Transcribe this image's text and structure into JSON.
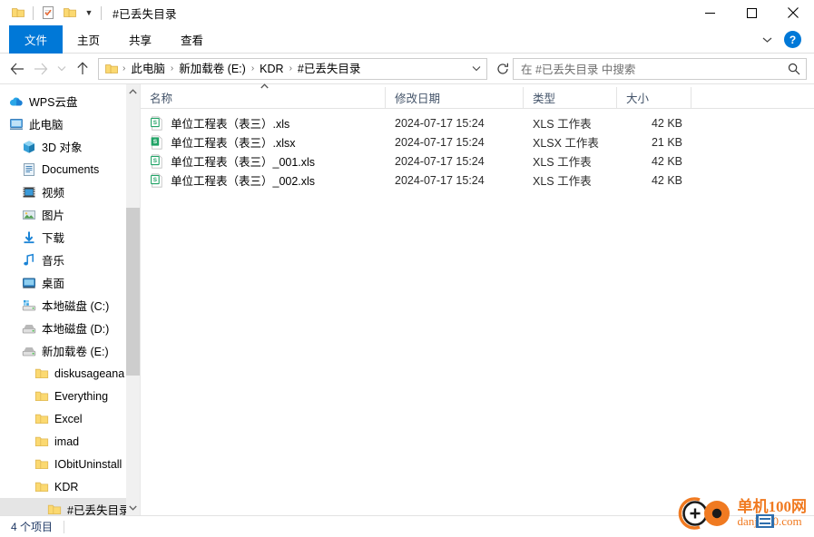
{
  "window": {
    "title": "#已丢失目录",
    "quick_access": [
      {
        "name": "folder-icon",
        "label": "文件夹"
      },
      {
        "name": "properties-icon",
        "label": "属性"
      },
      {
        "name": "new-folder-icon",
        "label": "新建文件夹"
      }
    ],
    "controls": {
      "minimize": "—",
      "maximize": "□",
      "close": "✕",
      "ribbon_chevron": "⌄",
      "help": "?"
    }
  },
  "ribbon": {
    "tabs": [
      {
        "label": "文件",
        "active": true
      },
      {
        "label": "主页",
        "active": false
      },
      {
        "label": "共享",
        "active": false
      },
      {
        "label": "查看",
        "active": false
      }
    ]
  },
  "address_bar": {
    "back": "←",
    "forward": "→",
    "recent": "⌄",
    "up": "↑",
    "breadcrumbs": [
      "此电脑",
      "新加载卷 (E:)",
      "KDR",
      "#已丢失目录"
    ],
    "separator": "›",
    "dropdown": "⌄",
    "refresh": "↺"
  },
  "search": {
    "placeholder": "在 #已丢失目录 中搜索",
    "icon": "search-icon"
  },
  "sidebar": {
    "items": [
      {
        "label": "WPS云盘",
        "icon": "cloud-icon",
        "indent": 0,
        "selected": false
      },
      {
        "label": "此电脑",
        "icon": "computer-icon",
        "indent": 0,
        "selected": false
      },
      {
        "label": "3D 对象",
        "icon": "3d-object-icon",
        "indent": 1,
        "selected": false
      },
      {
        "label": "Documents",
        "icon": "documents-icon",
        "indent": 1,
        "selected": false
      },
      {
        "label": "视频",
        "icon": "videos-icon",
        "indent": 1,
        "selected": false
      },
      {
        "label": "图片",
        "icon": "pictures-icon",
        "indent": 1,
        "selected": false
      },
      {
        "label": "下载",
        "icon": "downloads-icon",
        "indent": 1,
        "selected": false
      },
      {
        "label": "音乐",
        "icon": "music-icon",
        "indent": 1,
        "selected": false
      },
      {
        "label": "桌面",
        "icon": "desktop-icon",
        "indent": 1,
        "selected": false
      },
      {
        "label": "本地磁盘 (C:)",
        "icon": "drive-system-icon",
        "indent": 1,
        "selected": false
      },
      {
        "label": "本地磁盘 (D:)",
        "icon": "drive-icon",
        "indent": 1,
        "selected": false
      },
      {
        "label": "新加载卷 (E:)",
        "icon": "drive-icon",
        "indent": 1,
        "selected": false
      },
      {
        "label": "diskusageana",
        "icon": "folder-icon",
        "indent": 2,
        "selected": false
      },
      {
        "label": "Everything",
        "icon": "folder-icon",
        "indent": 2,
        "selected": false
      },
      {
        "label": "Excel",
        "icon": "folder-icon",
        "indent": 2,
        "selected": false
      },
      {
        "label": "imad",
        "icon": "folder-icon",
        "indent": 2,
        "selected": false
      },
      {
        "label": "IObitUninstall",
        "icon": "folder-icon",
        "indent": 2,
        "selected": false
      },
      {
        "label": "KDR",
        "icon": "folder-icon",
        "indent": 2,
        "selected": false
      },
      {
        "label": "#已丢失目录",
        "icon": "folder-icon",
        "indent": 3,
        "selected": true
      }
    ],
    "scrollbar": {
      "up": "⌃",
      "down": "⌄"
    }
  },
  "filelist": {
    "columns": [
      {
        "key": "name",
        "label": "名称"
      },
      {
        "key": "date",
        "label": "修改日期"
      },
      {
        "key": "type",
        "label": "类型"
      },
      {
        "key": "size",
        "label": "大小"
      }
    ],
    "sort": {
      "column": "名称",
      "direction": "asc",
      "glyph": "⌃"
    },
    "rows": [
      {
        "name": "单位工程表（表三）.xls",
        "date": "2024-07-17 15:24",
        "type": "XLS 工作表",
        "size": "42 KB",
        "icon": "xls-file-icon"
      },
      {
        "name": "单位工程表（表三）.xlsx",
        "date": "2024-07-17 15:24",
        "type": "XLSX 工作表",
        "size": "21 KB",
        "icon": "xlsx-file-icon"
      },
      {
        "name": "单位工程表（表三）_001.xls",
        "date": "2024-07-17 15:24",
        "type": "XLS 工作表",
        "size": "42 KB",
        "icon": "xls-file-icon"
      },
      {
        "name": "单位工程表（表三）_002.xls",
        "date": "2024-07-17 15:24",
        "type": "XLS 工作表",
        "size": "42 KB",
        "icon": "xls-file-icon"
      }
    ]
  },
  "statusbar": {
    "item_count": "4 个项目"
  },
  "watermark": {
    "title": "单机100网",
    "url": "danji100.com"
  },
  "colors": {
    "accent": "#0078d7",
    "selection": "#e5e5e5",
    "header_text": "#44546a",
    "status_text": "#1f3864",
    "watermark": "#f07a21",
    "folder": "#fbd971",
    "excel_green": "#1e9e54"
  }
}
